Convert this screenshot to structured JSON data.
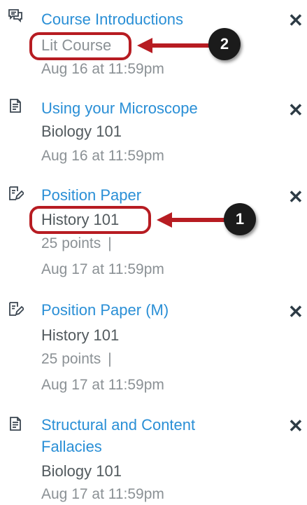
{
  "todo_items": [
    {
      "icon": "discussion-icon",
      "title": "Course Introductions",
      "course": "Lit Course",
      "due": "Aug 16 at 11:59pm"
    },
    {
      "icon": "page-icon",
      "title": "Using your Microscope",
      "course": "Biology 101",
      "due": "Aug 16 at 11:59pm"
    },
    {
      "icon": "assignment-icon",
      "title": "Position Paper",
      "course": "History 101",
      "points": "25 points",
      "separator": "|",
      "due": "Aug 17 at 11:59pm"
    },
    {
      "icon": "assignment-icon",
      "title": "Position Paper (M)",
      "course": "History 101",
      "points": "25 points",
      "separator": "|",
      "due": "Aug 17 at 11:59pm"
    },
    {
      "icon": "page-icon",
      "title_line1": "Structural and Content",
      "title_line2": "Fallacies",
      "course": "Biology 101",
      "due": "Aug 17 at 11:59pm"
    }
  ],
  "dismiss_glyph": "✕",
  "callouts": [
    {
      "number": "2"
    },
    {
      "number": "1"
    }
  ],
  "colors": {
    "link": "#2a8fd6",
    "text": "#525a5e",
    "muted": "#8b9195",
    "callout_red": "#b71c22",
    "badge": "#1b1b1b"
  }
}
